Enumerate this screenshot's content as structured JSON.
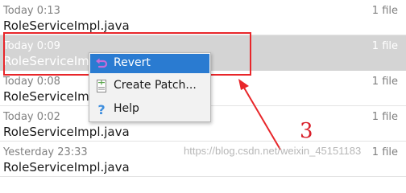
{
  "history": [
    {
      "date": "Today 0:13",
      "file": "RoleServiceImpl.java",
      "count": "1 file",
      "selected": false
    },
    {
      "date": "Today 0:09",
      "file": "RoleServiceImpl.java",
      "count": "1 file",
      "selected": true
    },
    {
      "date": "Today 0:08",
      "file": "RoleServiceImpl.java",
      "count": "1 file",
      "selected": false
    },
    {
      "date": "Today 0:02",
      "file": "RoleServiceImpl.java",
      "count": "1 file",
      "selected": false
    },
    {
      "date": "Yesterday 23:33",
      "file": "RoleServiceImpl.java",
      "count": "1 file",
      "selected": false
    }
  ],
  "context_menu": {
    "items": [
      {
        "label": "Revert",
        "icon": "revert-icon",
        "highlighted": true
      },
      {
        "label": "Create Patch...",
        "icon": "create-patch-icon",
        "highlighted": false
      },
      {
        "label": "Help",
        "icon": "help-icon",
        "highlighted": false
      }
    ]
  },
  "annotation": {
    "step_number": "3",
    "watermark": "https://blog.csdn.net/weixin_45151183",
    "color": "#e8262a"
  },
  "colors": {
    "selected_row": "#d4d4d4",
    "menu_highlight": "#2a7bd1"
  }
}
